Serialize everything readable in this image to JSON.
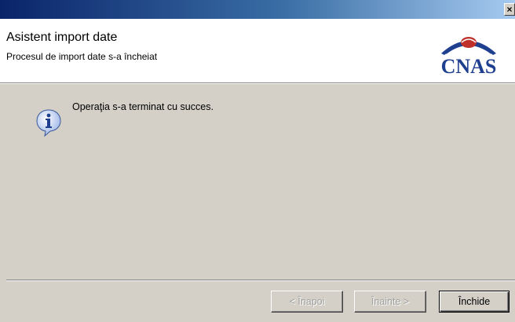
{
  "window": {
    "close_glyph": "×"
  },
  "header": {
    "title": "Asistent import date",
    "subtitle": "Procesul de import date s-a încheiat",
    "logo_text": "CNAS",
    "logo_color": "#1f3f8f",
    "logo_accent": "#c0302a"
  },
  "main": {
    "message": "Operaţia s-a terminat cu succes.",
    "icon": "info-icon"
  },
  "footer": {
    "back_label": "< Înapoi",
    "next_label": "Înainte >",
    "close_label": "Închide"
  },
  "colors": {
    "dialog_bg": "#d4d0c8",
    "titlebar_start": "#0a246a",
    "titlebar_end": "#a6caf0"
  }
}
